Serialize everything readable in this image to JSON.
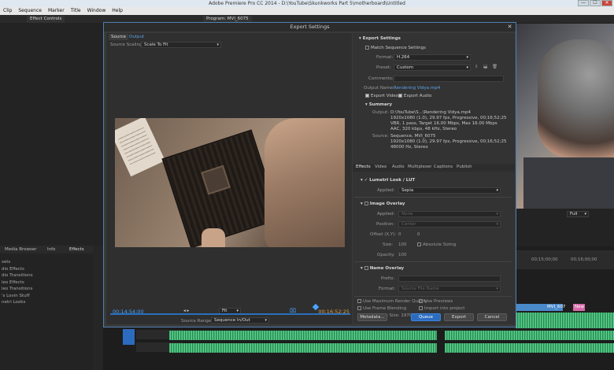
{
  "os": {
    "title": "Adobe Premiere Pro CC 2014 - D:\\YouTube\\Skunkworks Part 5\\motherboard\\Untitled",
    "min": "—",
    "max": "☐",
    "close": "✕"
  },
  "menu": [
    "Clip",
    "Sequence",
    "Marker",
    "Title",
    "Window",
    "Help"
  ],
  "panel_tabs": [
    "Effect Controls",
    "Program: MVI_6075"
  ],
  "left_panel": {
    "tabs": [
      "Media Browser",
      "Info",
      "Effects"
    ],
    "items": [
      "sets",
      "dio Effects",
      "dio Transitions",
      "leo Effects",
      "leo Transitions",
      "'s Lovin Stuff",
      "netri Looks"
    ]
  },
  "dialog": {
    "title": "Export Settings",
    "close": "✕",
    "source_tabs": [
      "Source",
      "Output"
    ],
    "source_scaling_label": "Source Scaling:",
    "source_scaling_value": "Scale To Fit",
    "time_in": "00;14;54;00",
    "time_out": "00;16;52;25",
    "fit_value": "Fit",
    "source_range_label": "Source Range:",
    "source_range_value": "Sequence In/Out",
    "export_settings": {
      "header": "Export Settings",
      "match_sequence": "Match Sequence Settings",
      "format_label": "Format:",
      "format_value": "H.264",
      "preset_label": "Preset:",
      "preset_value": "Custom",
      "comments_label": "Comments:",
      "output_name_label": "Output Name:",
      "output_name_value": "Rendering Vidya.mp4",
      "export_video": "Export Video",
      "export_audio": "Export Audio"
    },
    "summary": {
      "header": "Summary",
      "output_label": "Output:",
      "output_lines": [
        "D:\\YouTube\\S...\\Rendering Vidya.mp4",
        "1920x1080 (1.0), 29.97 fps, Progressive, 00;16;52;25",
        "VBR, 1 pass, Target 16.00 Mbps, Max 16.00 Mbps",
        "AAC, 320 kbps, 48 kHz, Stereo"
      ],
      "source_label": "Source:",
      "source_lines": [
        "Sequence, MVI_6075",
        "1920x1080 (1.0), 29.97 fps, Progressive, 00;16;52;25",
        "48000 Hz, Stereo"
      ]
    },
    "tabs": [
      "Effects",
      "Video",
      "Audio",
      "Multiplexer",
      "Captions",
      "Publish"
    ],
    "lumetri": {
      "header": "Lumetri Look / LUT",
      "applied_label": "Applied:",
      "applied_value": "Sepia"
    },
    "image_overlay": {
      "header": "Image Overlay",
      "applied_label": "Applied:",
      "applied_value": "None",
      "position_label": "Position:",
      "position_value": "Center",
      "offset_label": "Offset (X,Y):",
      "offset_x": "0",
      "offset_y": "0",
      "size_label": "Size:",
      "size_value": "100",
      "absolute_sizing": "Absolute Sizing",
      "opacity_label": "Opacity:",
      "opacity_value": "100"
    },
    "name_overlay": {
      "header": "Name Overlay",
      "prefix_label": "Prefix:",
      "format_label": "Format:",
      "format_value": "Source File Name"
    },
    "use_max_render": "Use Maximum Render Quality",
    "use_previews": "Use Previews",
    "use_frame_blending": "Use Frame Blending",
    "import_into_project": "Import into project",
    "file_size": "Estimated File Size: 1970 MB",
    "buttons": {
      "metadata": "Metadata...",
      "queue": "Queue",
      "export": "Export",
      "cancel": "Cancel"
    }
  },
  "program_monitor": {
    "fit": "Full",
    "timecodes": [
      "00;15;00;00",
      "00;16;00;00"
    ]
  },
  "timeline": {
    "clip_labels": [
      "MVI_607",
      "New"
    ]
  },
  "colors": {
    "accent": "#2c6cbf",
    "time_in": "#4aa3ff",
    "time_out": "#e0a040",
    "link": "#5aa3e8"
  }
}
